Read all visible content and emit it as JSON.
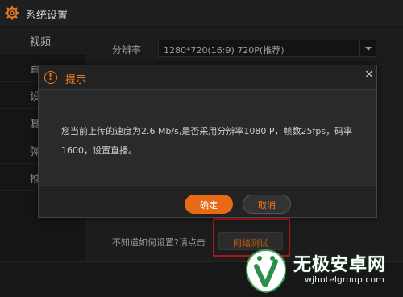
{
  "window": {
    "title": "系统设置",
    "icon": "gear-icon"
  },
  "sidebar": {
    "items": [
      {
        "label": "视频",
        "active": true
      },
      {
        "label": "直"
      },
      {
        "label": "设"
      },
      {
        "label": "其"
      },
      {
        "label": "弹"
      },
      {
        "label": "推"
      }
    ]
  },
  "video": {
    "resolution_label": "分辨率",
    "resolution_value": "1280*720(16:9) 720P(推荐)",
    "hint_text": "不知道如何设置?请点击",
    "network_test_label": "网络测试"
  },
  "dialog": {
    "title": "提示",
    "icon": "warning-icon",
    "message": "您当前上传的速度为2.6 Mb/s,是否采用分辨率1080 P，帧数25fps，码率1600，设置直播。",
    "ok_label": "确定",
    "cancel_label": "取消",
    "close_symbol": "×"
  },
  "watermark": {
    "title": "无极安卓网",
    "url": "wjhotelgroup.com"
  },
  "colors": {
    "accent": "#f07a1c",
    "highlight": "#e01e28",
    "background": "#262626"
  }
}
